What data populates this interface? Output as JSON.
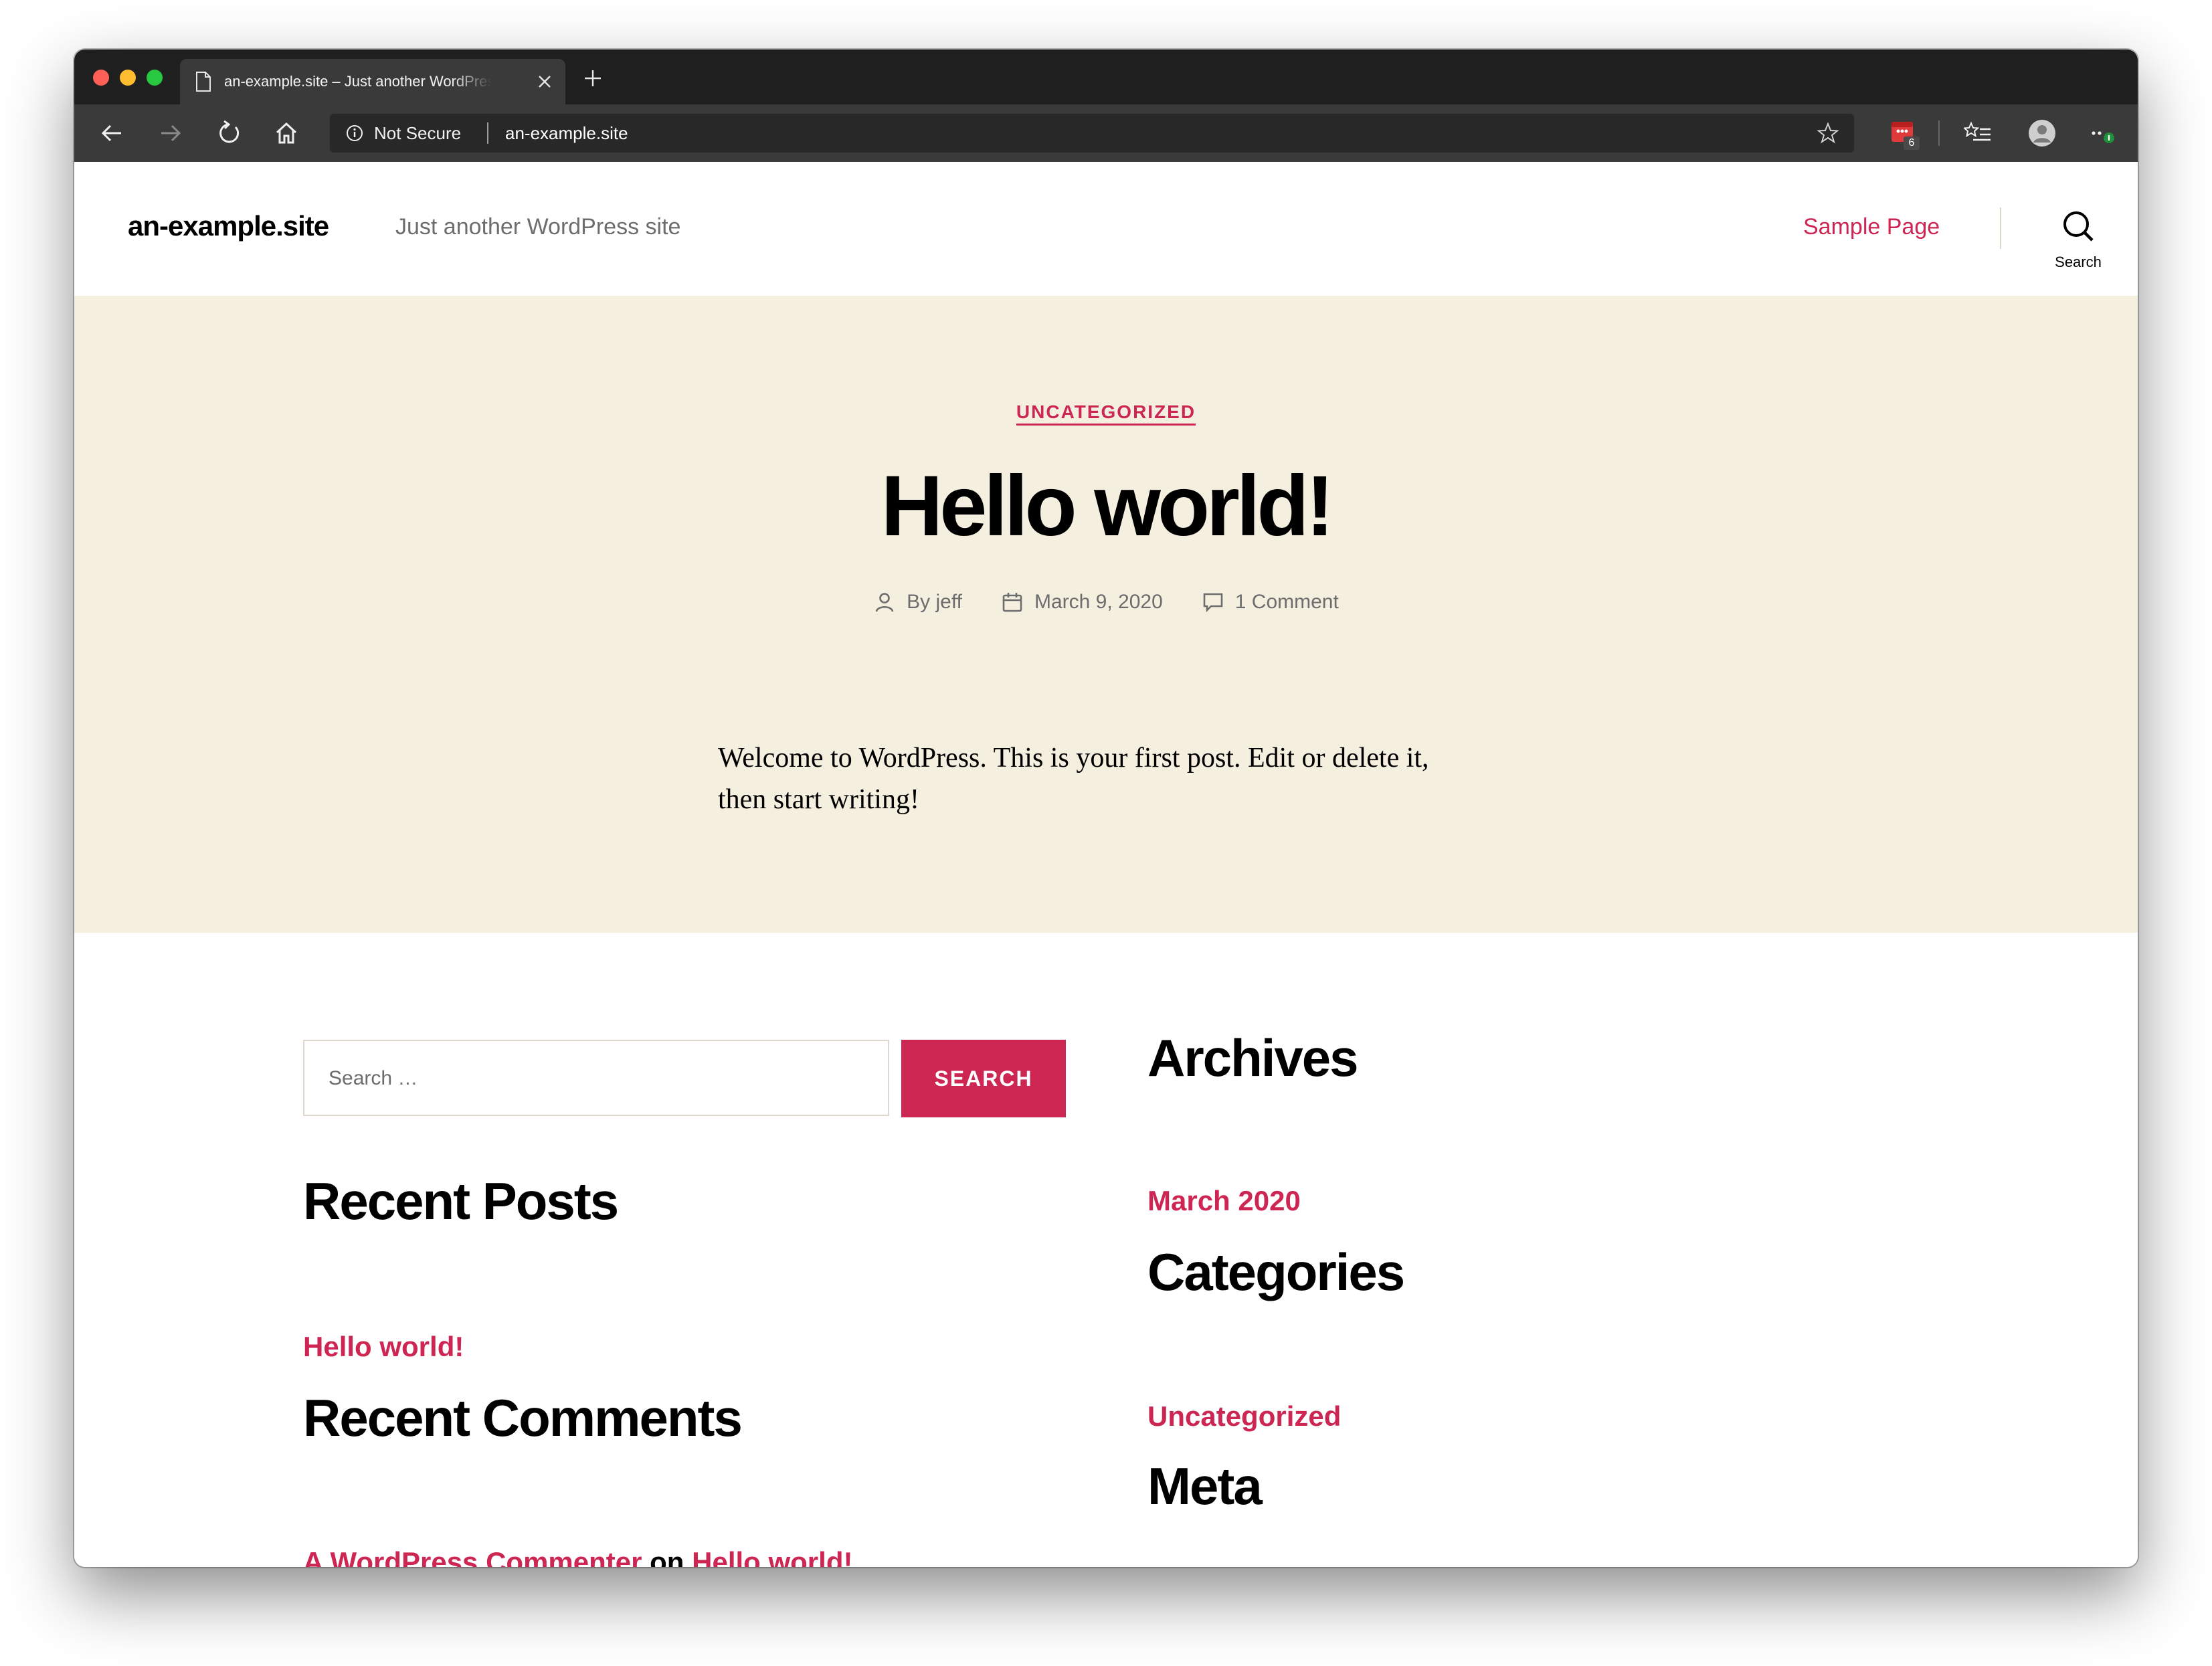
{
  "browser": {
    "tab_title": "an-example.site – Just another WordPress site",
    "security_label": "Not Secure",
    "url": "an-example.site",
    "extension_badge": "6"
  },
  "site": {
    "title": "an-example.site",
    "description": "Just another WordPress site",
    "nav_sample_page": "Sample Page",
    "search_toggle_label": "Search"
  },
  "post": {
    "category": "UNCATEGORIZED",
    "title": "Hello world!",
    "author": "By jeff",
    "date": "March 9, 2020",
    "comments": "1 Comment",
    "body": "Welcome to WordPress. This is your first post. Edit or delete it, then start writing!"
  },
  "widgets": {
    "search_placeholder": "Search …",
    "search_button": "SEARCH",
    "recent_posts_heading": "Recent Posts",
    "recent_post_link": "Hello world!",
    "recent_comments_heading": "Recent Comments",
    "comment_author": "A WordPress Commenter",
    "comment_on": "on",
    "comment_post": "Hello world!",
    "archives_heading": "Archives",
    "archive_link": "March 2020",
    "categories_heading": "Categories",
    "category_link": "Uncategorized",
    "meta_heading": "Meta"
  },
  "colors": {
    "accent": "#cd2653",
    "hero_background": "#f5efe0",
    "chrome_dark": "#1f1f1f"
  }
}
